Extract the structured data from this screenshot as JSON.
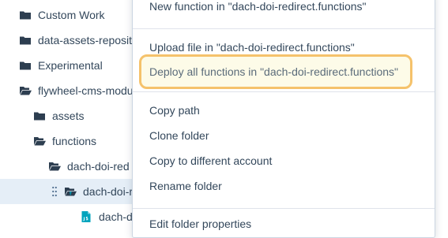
{
  "tree": {
    "items": [
      {
        "label": "Custom Work",
        "icon": "folder-icon"
      },
      {
        "label": "data-assets-reposito",
        "icon": "folder-icon"
      },
      {
        "label": "Experimental",
        "icon": "folder-icon"
      },
      {
        "label": "flywheel-cms-modu",
        "icon": "folder-open-icon"
      },
      {
        "label": "assets",
        "icon": "folder-icon"
      },
      {
        "label": "functions",
        "icon": "folder-open-icon"
      },
      {
        "label": "dach-doi-red",
        "icon": "folder-open-icon"
      },
      {
        "label": "dach-doi-r",
        "icon": "functions-folder-icon",
        "selected": true
      },
      {
        "label": "dach-d",
        "icon": "js-file-icon"
      }
    ]
  },
  "menu": {
    "items": [
      "New function in \"dach-doi-redirect.functions\"",
      "Upload file in \"dach-doi-redirect.functions\"",
      "Deploy all functions in \"dach-doi-redirect.functions\"",
      "Copy path",
      "Clone folder",
      "Copy to different account",
      "Rename folder",
      "Edit folder properties"
    ],
    "highlighted_index": 2
  },
  "colors": {
    "text": "#33475b",
    "folder_icon": "#2d3e50",
    "js_icon": "#00a4bd",
    "selection": "#e5eef7",
    "highlight_border": "#f5c26b",
    "highlight_fill": "#fdfbe8"
  }
}
